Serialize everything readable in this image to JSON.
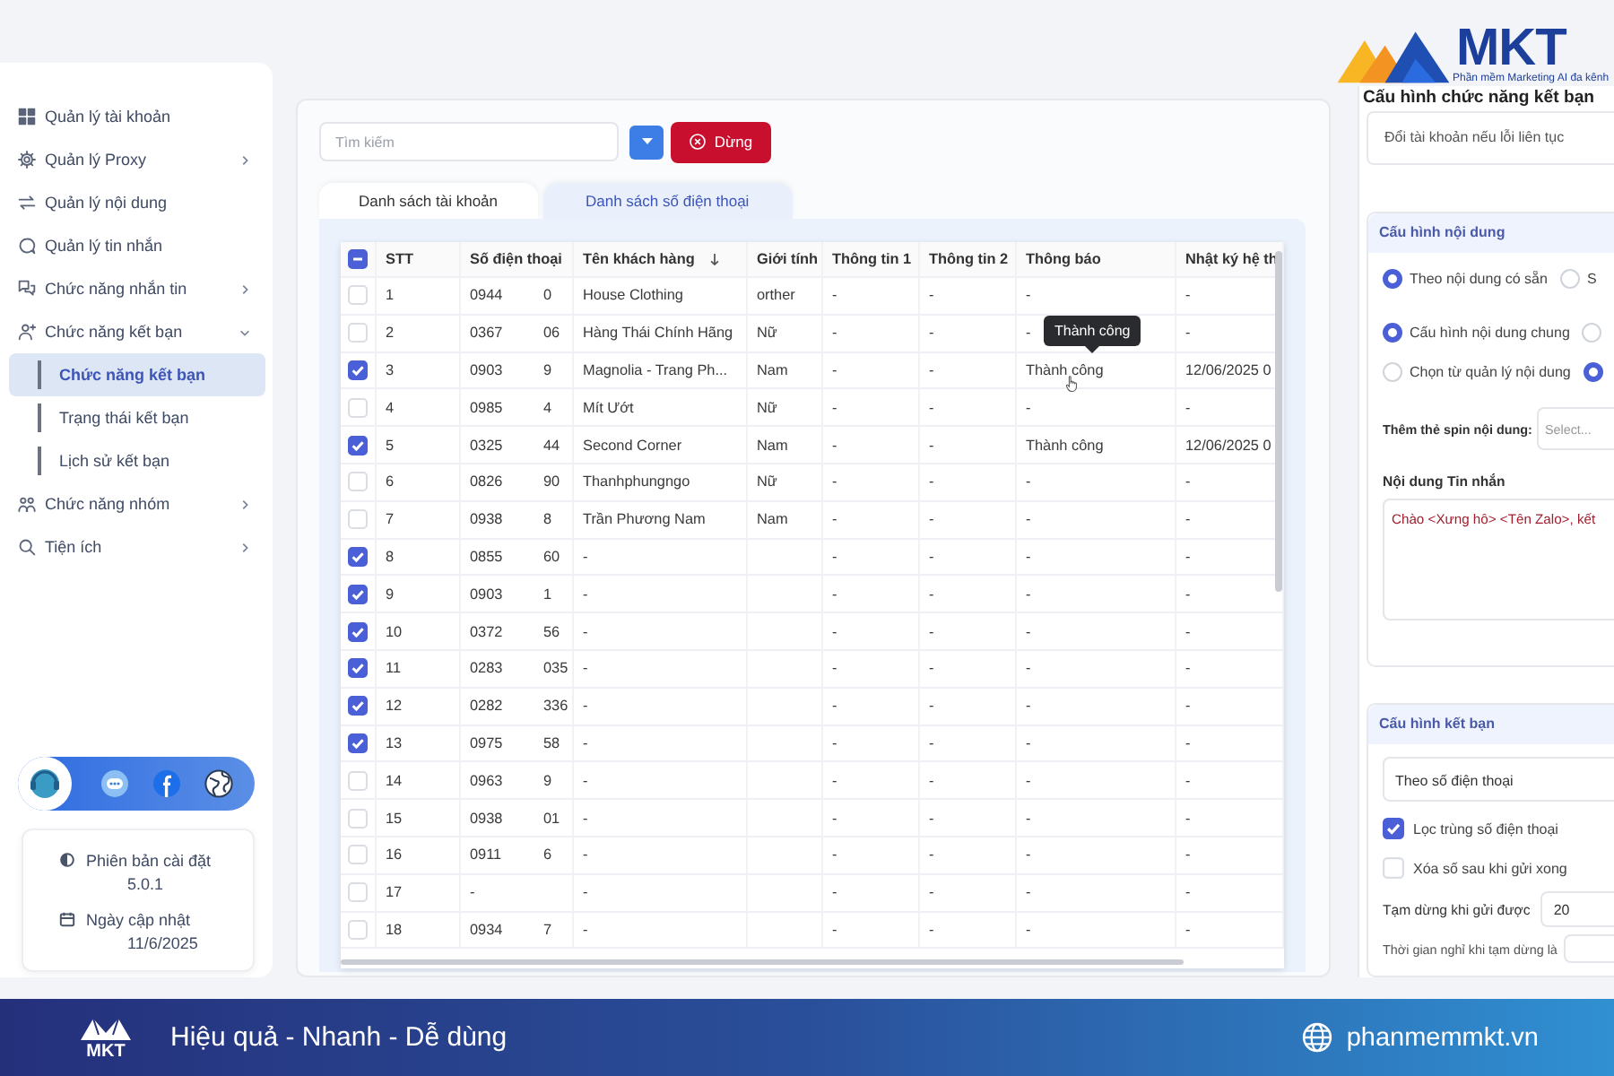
{
  "logo": {
    "text": "MKT",
    "tagline": "Phần mềm Marketing AI đa kênh"
  },
  "sidebar": {
    "items": [
      {
        "label": "Quản lý tài khoản",
        "selected": false,
        "expandable": false
      },
      {
        "label": "Quản lý Proxy",
        "selected": false,
        "expandable": true,
        "expanded": false
      },
      {
        "label": "Quản lý nội dung",
        "selected": false,
        "expandable": false
      },
      {
        "label": "Quản lý tin nhắn",
        "selected": false,
        "expandable": false
      },
      {
        "label": "Chức năng nhắn tin",
        "selected": false,
        "expandable": true,
        "expanded": false
      },
      {
        "label": "Chức năng kết bạn",
        "selected": false,
        "expandable": true,
        "expanded": true,
        "children": [
          {
            "label": "Chức năng kết bạn",
            "selected": true
          },
          {
            "label": "Trạng thái kết bạn",
            "selected": false
          },
          {
            "label": "Lịch sử kết bạn",
            "selected": false
          }
        ]
      },
      {
        "label": "Chức năng nhóm",
        "selected": false,
        "expandable": true,
        "expanded": false
      },
      {
        "label": "Tiện ích",
        "selected": false,
        "expandable": true,
        "expanded": false
      }
    ],
    "version_card": {
      "version_label": "Phiên bản cài đặt",
      "version": "5.0.1",
      "date_label": "Ngày cập nhật",
      "date": "11/6/2025"
    }
  },
  "toolbar": {
    "search": {
      "placeholder": "Tìm kiếm"
    },
    "stop_button": "Dừng"
  },
  "tabs": [
    {
      "label": "Danh sách tài khoản",
      "selected": false
    },
    {
      "label": "Danh sách số điện thoại",
      "selected": true
    }
  ],
  "table": {
    "select_all": {
      "checked": false,
      "partial": true
    },
    "columns": [
      {
        "label": "STT",
        "sorted": false
      },
      {
        "label": "Số điện thoại",
        "sorted": false
      },
      {
        "label": "Tên khách hàng",
        "sorted": true
      },
      {
        "label": "Giới tính",
        "sorted": false
      },
      {
        "label": "Thông tin 1",
        "sorted": false
      },
      {
        "label": "Thông tin 2",
        "sorted": false
      },
      {
        "label": "Thông báo",
        "sorted": false
      },
      {
        "label": "Nhật ký hệ th",
        "sorted": false
      }
    ],
    "rows": [
      {
        "stt": "1",
        "checked": false,
        "phone": "0944",
        "phone_tail": "0",
        "name": "House Clothing",
        "gender": "orther",
        "info_1": "-",
        "info_2": "-",
        "notice": "-",
        "log": "-"
      },
      {
        "stt": "2",
        "checked": false,
        "phone": "0367",
        "phone_tail": "06",
        "name": "Hàng Thái Chính Hãng",
        "gender": "Nữ",
        "info_1": "-",
        "info_2": "-",
        "notice": "-",
        "log": "-"
      },
      {
        "stt": "3",
        "checked": true,
        "phone": "0903",
        "phone_tail": "9",
        "name": "Magnolia - Trang Ph...",
        "gender": "Nam",
        "info_1": "-",
        "info_2": "-",
        "notice": "Thành công",
        "tooltip": "Thành công",
        "log": "12/06/2025 0"
      },
      {
        "stt": "4",
        "checked": false,
        "phone": "0985",
        "phone_tail": "4",
        "name": "Mít Ướt",
        "gender": "Nữ",
        "info_1": "-",
        "info_2": "-",
        "notice": "-",
        "log": "-"
      },
      {
        "stt": "5",
        "checked": true,
        "phone": "0325",
        "phone_tail": "44",
        "name": "Second Corner",
        "gender": "Nam",
        "info_1": "-",
        "info_2": "-",
        "notice": "Thành công",
        "log": "12/06/2025 0"
      },
      {
        "stt": "6",
        "checked": false,
        "phone": "0826",
        "phone_tail": "90",
        "name": "Thanhphungngo",
        "gender": "Nữ",
        "info_1": "-",
        "info_2": "-",
        "notice": "-",
        "log": "-"
      },
      {
        "stt": "7",
        "checked": false,
        "phone": "0938",
        "phone_tail": "8",
        "name": "Trần Phương Nam",
        "gender": "Nam",
        "info_1": "-",
        "info_2": "-",
        "notice": "-",
        "log": "-"
      },
      {
        "stt": "8",
        "checked": true,
        "phone": "0855",
        "phone_tail": "60",
        "name": "-",
        "info_1": "-",
        "info_2": "-",
        "notice": "-",
        "log": "-"
      },
      {
        "stt": "9",
        "checked": true,
        "phone": "0903",
        "phone_tail": "1",
        "name": "-",
        "info_1": "-",
        "info_2": "-",
        "notice": "-",
        "log": "-"
      },
      {
        "stt": "10",
        "checked": true,
        "phone": "0372",
        "phone_tail": "56",
        "name": "-",
        "info_1": "-",
        "info_2": "-",
        "notice": "-",
        "log": "-"
      },
      {
        "stt": "11",
        "checked": true,
        "phone": "0283",
        "phone_tail": "035",
        "name": "-",
        "info_1": "-",
        "info_2": "-",
        "notice": "-",
        "log": "-"
      },
      {
        "stt": "12",
        "checked": true,
        "phone": "0282",
        "phone_tail": "336",
        "name": "-",
        "info_1": "-",
        "info_2": "-",
        "notice": "-",
        "log": "-"
      },
      {
        "stt": "13",
        "checked": true,
        "phone": "0975",
        "phone_tail": "58",
        "name": "-",
        "info_1": "-",
        "info_2": "-",
        "notice": "-",
        "log": "-"
      },
      {
        "stt": "14",
        "checked": false,
        "phone": "0963",
        "phone_tail": "9",
        "name": "-",
        "info_1": "-",
        "info_2": "-",
        "notice": "-",
        "log": "-"
      },
      {
        "stt": "15",
        "checked": false,
        "phone": "0938",
        "phone_tail": "01",
        "name": "-",
        "info_1": "-",
        "info_2": "-",
        "notice": "-",
        "log": "-"
      },
      {
        "stt": "16",
        "checked": false,
        "phone": "0911",
        "phone_tail": "6",
        "name": "-",
        "info_1": "-",
        "info_2": "-",
        "notice": "-",
        "log": "-"
      },
      {
        "stt": "17",
        "checked": false,
        "phone": "-",
        "name": "-",
        "info_1": "-",
        "info_2": "-",
        "notice": "-",
        "log": "-"
      },
      {
        "stt": "18",
        "checked": false,
        "phone": "0934",
        "phone_tail": "7",
        "name": "-",
        "info_1": "-",
        "info_2": "-",
        "notice": "-",
        "log": "-"
      }
    ]
  },
  "config": {
    "title": "Cấu hình chức năng kết bạn",
    "account_option": "Đổi tài khoản nếu lỗi liên tục",
    "content": {
      "title": "Cấu hình nội dung",
      "radio_rows": [
        [
          {
            "label": "Theo nội dung có sẵn",
            "selected": true
          },
          {
            "label": "S",
            "selected": false
          }
        ],
        [
          {
            "label": "Cấu hình nội dung chung",
            "selected": true
          },
          {
            "selected": false
          }
        ],
        [
          {
            "label": "Chọn từ quản lý nội dung",
            "selected": false
          },
          {
            "selected": true
          }
        ]
      ],
      "spin_label": "Thêm thẻ spin nội dung:",
      "spin_select": {
        "placeholder": "Select..."
      },
      "message_label": "Nội dung Tin nhắn",
      "message": "Chào <Xưng hô> <Tên Zalo>, kết"
    },
    "friend": {
      "title": "Cấu hình kết bạn",
      "mode": "Theo số điện thoại",
      "checkboxes": [
        {
          "label": "Lọc trùng số điện thoại",
          "checked": true
        },
        {
          "label": "Xóa số sau khi gửi xong",
          "checked": false
        }
      ],
      "pause_label": "Tạm dừng khi gửi được",
      "pause_value": "20",
      "rest_label": "Thời gian nghỉ khi tạm dừng là"
    }
  },
  "banner": {
    "logo_text": "MKT",
    "slogan": "Hiệu quả - Nhanh - Dễ dùng",
    "website": "phanmemmkt.vn"
  }
}
